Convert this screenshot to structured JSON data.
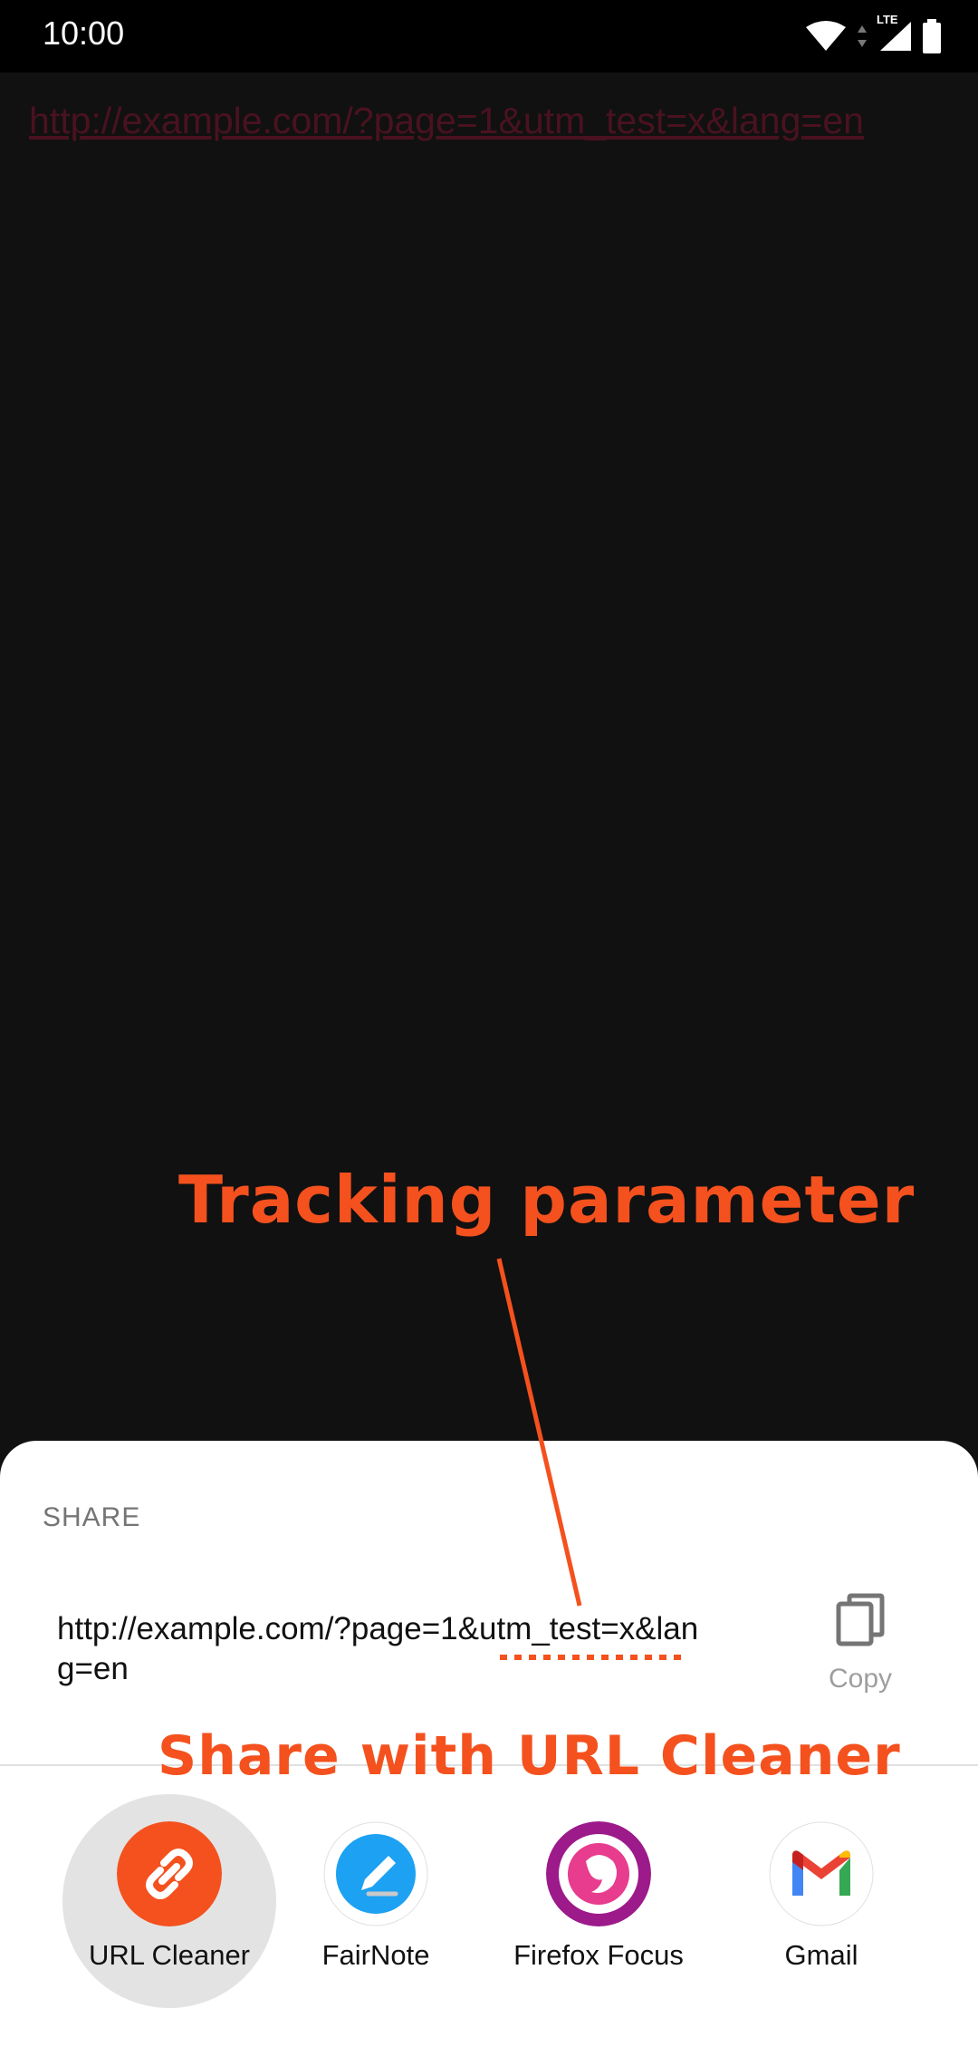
{
  "status_bar": {
    "time": "10:00",
    "network": "LTE"
  },
  "page": {
    "link_text": "http://example.com/?page=1&utm_test=x&lang=en"
  },
  "annotations": {
    "tracking": "Tracking parameter",
    "share_with": "Share with URL Cleaner",
    "color": "#f4511e"
  },
  "share_sheet": {
    "title": "SHARE",
    "url": "http://example.com/?page=1&utm_test=x&lang=en",
    "copy_label": "Copy",
    "apps": [
      {
        "label": "URL Cleaner",
        "icon": "link-icon",
        "color": "#f4511e"
      },
      {
        "label": "FairNote",
        "icon": "pencil-icon",
        "color": "#1da1f2"
      },
      {
        "label": "Firefox Focus",
        "icon": "firefox-focus-icon",
        "color": "#9c1a8a"
      },
      {
        "label": "Gmail",
        "icon": "gmail-icon",
        "color": "#ea4335"
      }
    ]
  }
}
